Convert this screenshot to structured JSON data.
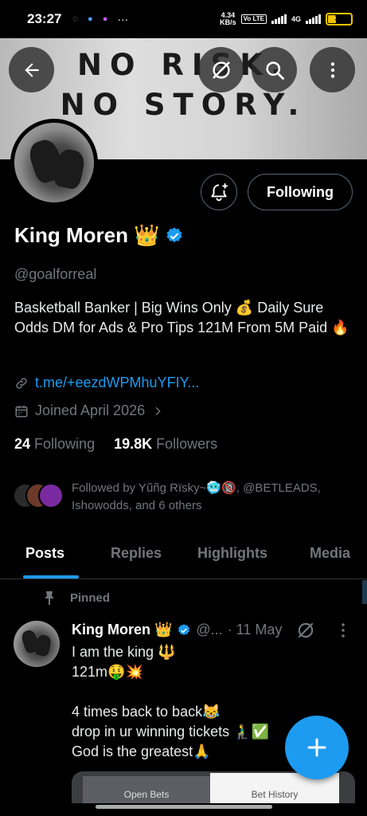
{
  "status_bar": {
    "time": "23:27",
    "speed_value": "4.34",
    "speed_unit": "KB/s",
    "volte": "Vo LTE",
    "network": "4G",
    "battery": "34",
    "battery_level": 0.34
  },
  "banner": {
    "line1": "NO RISK.",
    "line2": "NO STORY."
  },
  "profile": {
    "follow_button_label": "Following",
    "display_name": "King Moren 👑",
    "handle": "@goalforreal",
    "bio": "Basketball Banker | Big Wins Only 💰 Daily Sure Odds  DM for Ads & Pro Tips 121M From 5M Paid 🔥",
    "link": "t.me/+eezdWPMhuYFIY...",
    "joined": "Joined April 2026",
    "following_count": "24",
    "following_label": "Following",
    "followers_count": "19.8K",
    "followers_label": "Followers",
    "followed_by": "Followed by Yũñg Rïsky~🥶🔞, @BETLEADS, Ishowodds, and 6 others"
  },
  "tabs": [
    "Posts",
    "Replies",
    "Highlights",
    "Media"
  ],
  "pinned_post": {
    "pinned_label": "Pinned",
    "author_name": "King Moren 👑",
    "author_handle": "@...",
    "date": "· 11 May",
    "text": "I am the king 🔱\n121m🤑💥\n\n4 times back to back😹\ndrop in ur winning tickets 🧎‍♂️✅\nGod is the greatest🙏",
    "embed_tab_1": "Open Bets",
    "embed_tab_2": "Bet History"
  },
  "colors": {
    "accent": "#1d9bf0",
    "muted": "#71767b",
    "border": "#2f3336"
  }
}
